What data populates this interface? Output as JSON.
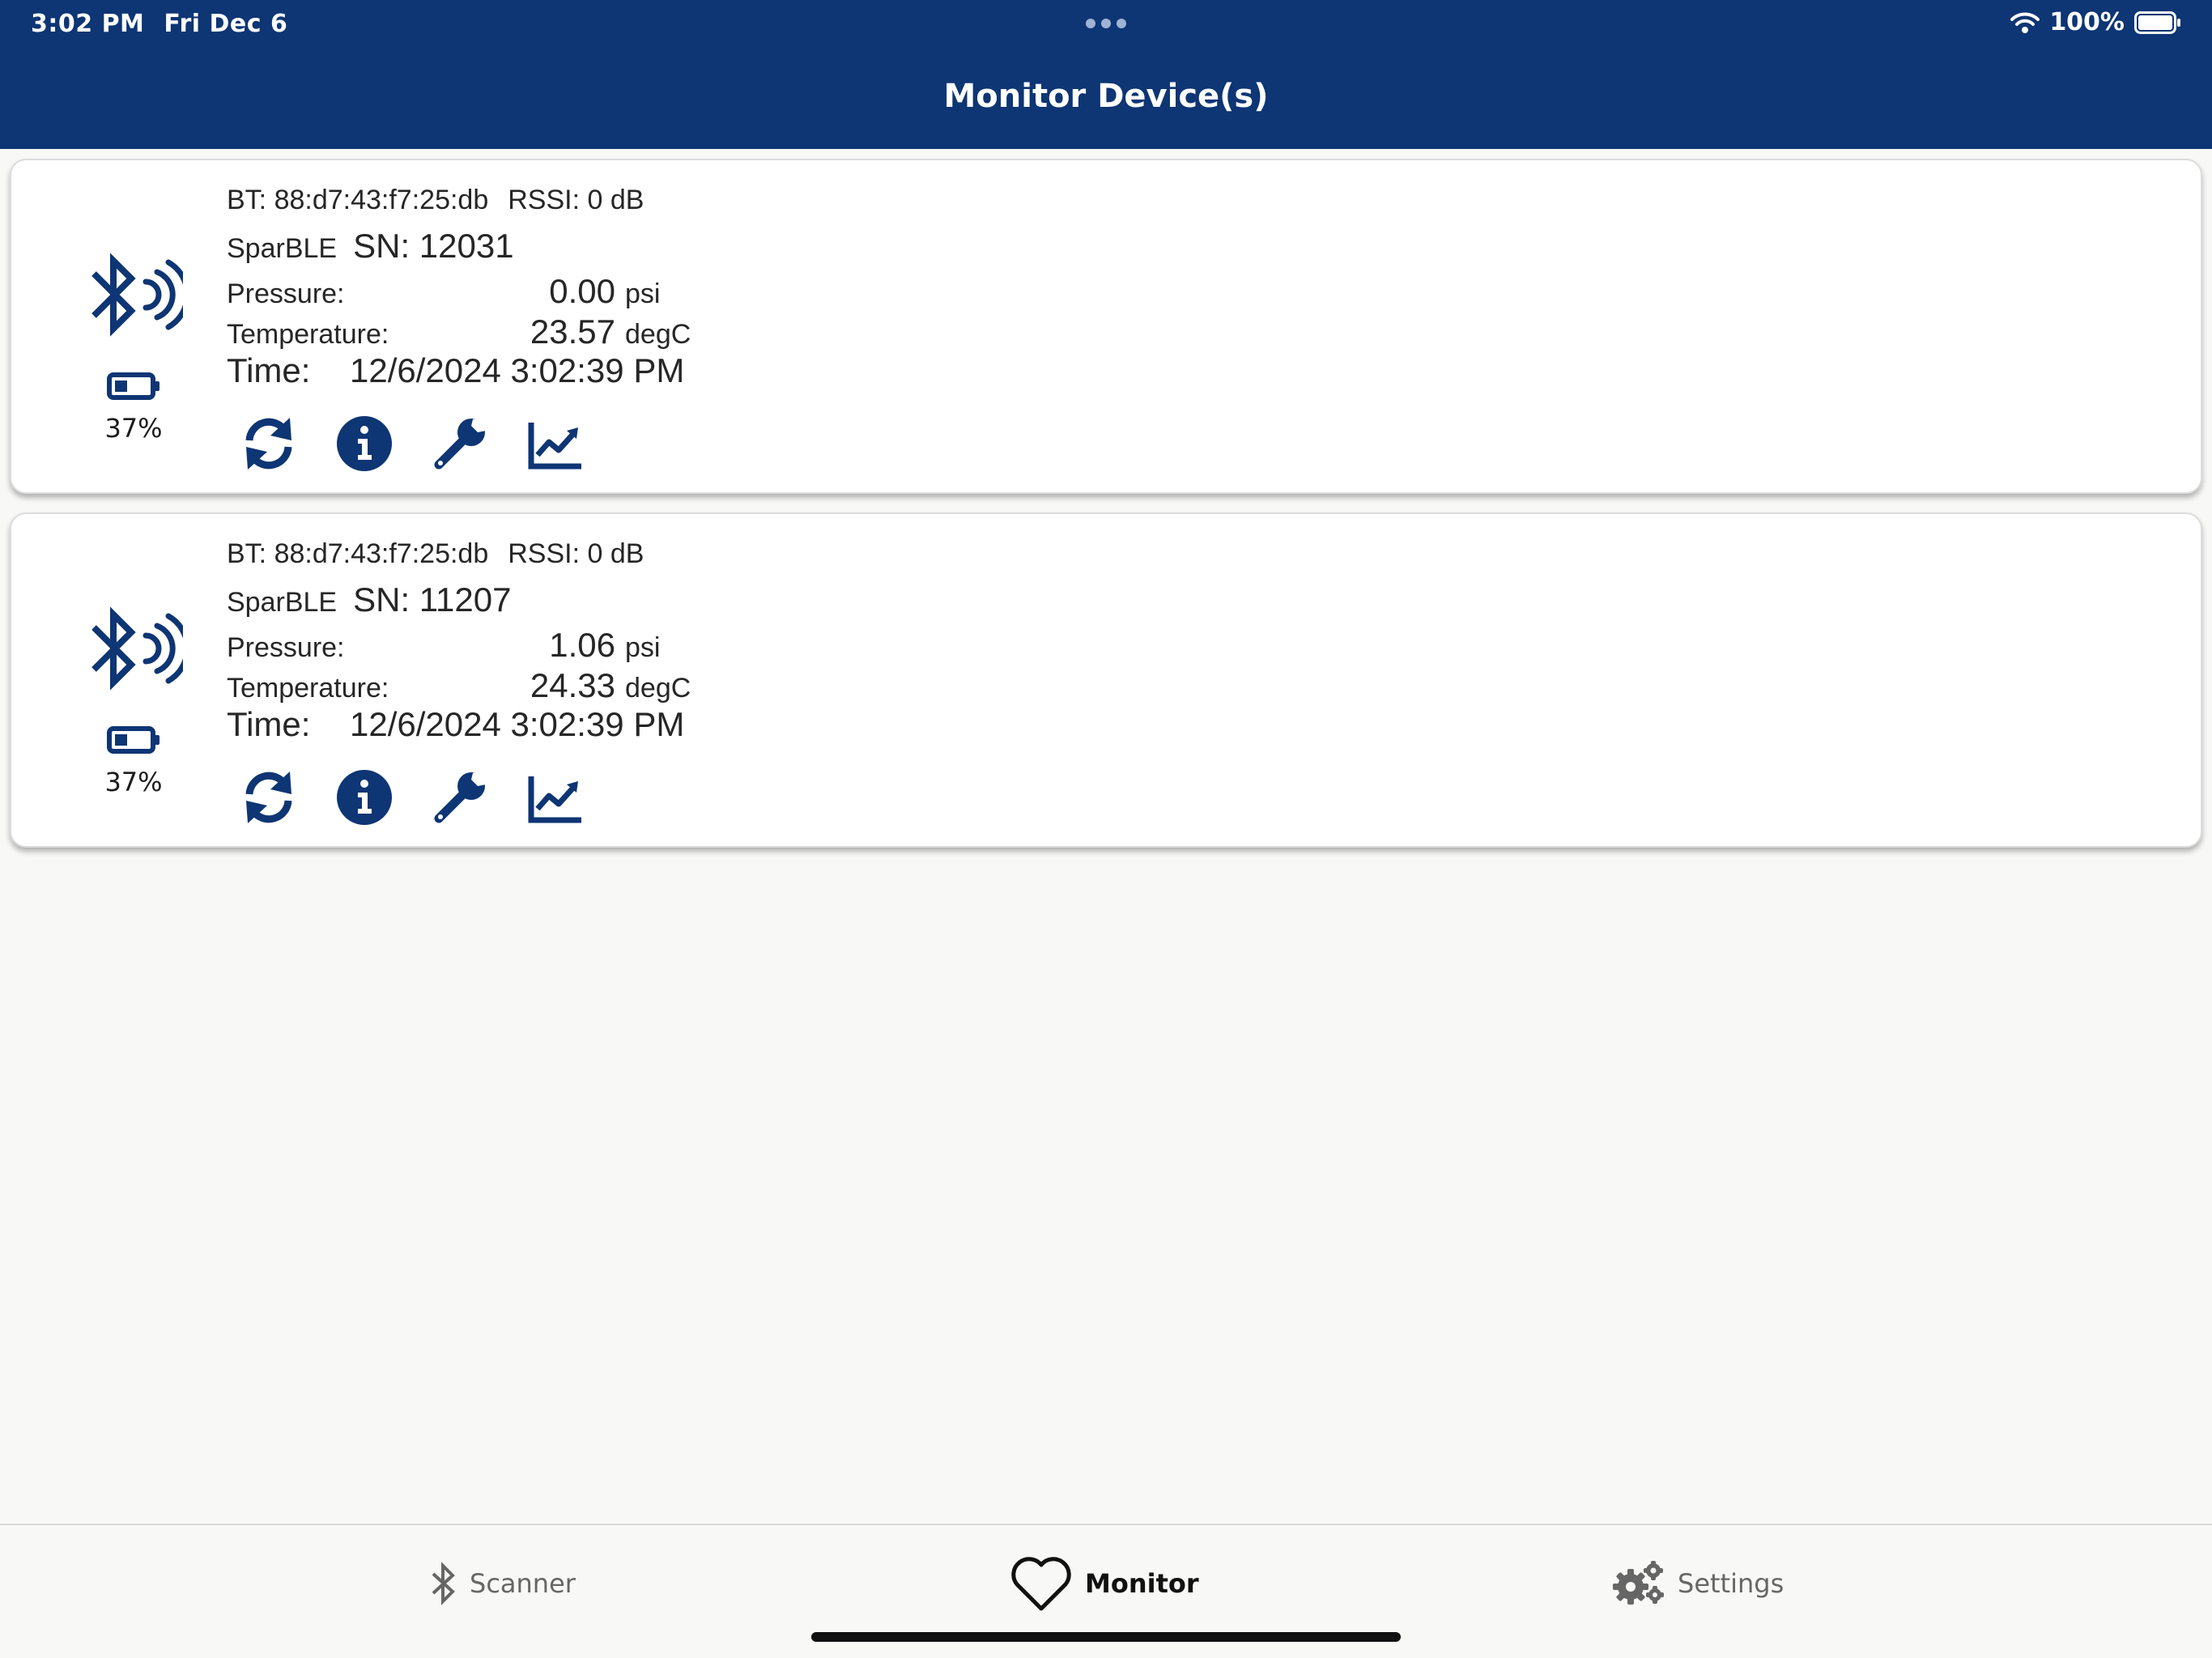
{
  "status_bar": {
    "time": "3:02 PM",
    "date": "Fri Dec 6",
    "battery": "100%"
  },
  "header": {
    "title": "Monitor Device(s)"
  },
  "colors": {
    "header_bg": "#0e3574",
    "accent": "#0e3574",
    "background": "#f8f8f7",
    "card_bg": "#ffffff"
  },
  "devices": [
    {
      "bt": "BT: 88:d7:43:f7:25:db",
      "rssi": "RSSI: 0 dB",
      "model": "SparBLE",
      "sn": "SN: 12031",
      "pressure_label": "Pressure:",
      "pressure_value": "0.00",
      "pressure_unit": "psi",
      "temperature_label": "Temperature:",
      "temperature_value": "23.57",
      "temperature_unit": "degC",
      "time_label": "Time:",
      "time_value": "12/6/2024 3:02:39 PM",
      "battery_pct": "37%",
      "battery_level": 0.37
    },
    {
      "bt": "BT: 88:d7:43:f7:25:db",
      "rssi": "RSSI: 0 dB",
      "model": "SparBLE",
      "sn": "SN: 11207",
      "pressure_label": "Pressure:",
      "pressure_value": "1.06",
      "pressure_unit": "psi",
      "temperature_label": "Temperature:",
      "temperature_value": "24.33",
      "temperature_unit": "degC",
      "time_label": "Time:",
      "time_value": "12/6/2024 3:02:39 PM",
      "battery_pct": "37%",
      "battery_level": 0.37
    }
  ],
  "device_actions": [
    "refresh-icon",
    "info-icon",
    "wrench-icon",
    "chart-line-icon"
  ],
  "tabs": [
    {
      "label": "Scanner",
      "icon": "bluetooth-icon",
      "active": false
    },
    {
      "label": "Monitor",
      "icon": "heart-icon",
      "active": true
    },
    {
      "label": "Settings",
      "icon": "gears-icon",
      "active": false
    }
  ]
}
